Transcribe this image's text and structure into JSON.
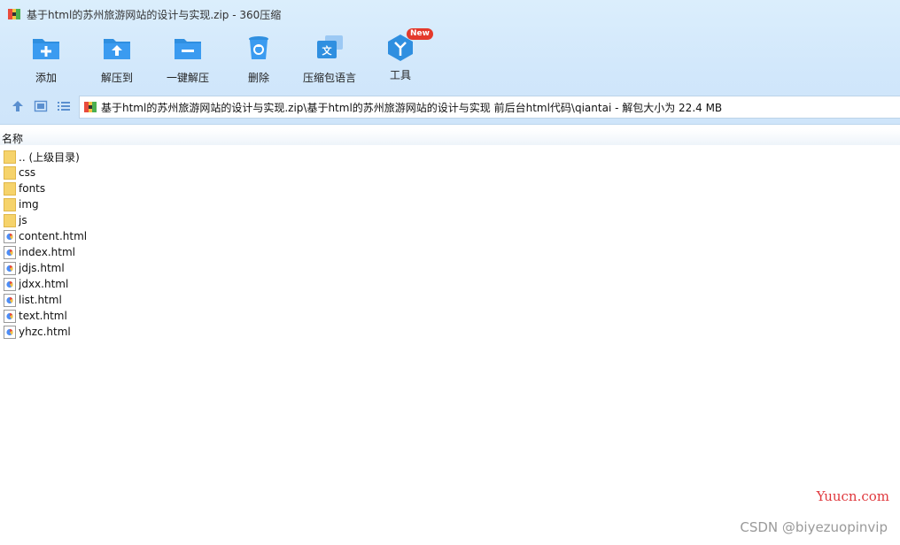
{
  "window": {
    "title": "基于html的苏州旅游网站的设计与实现.zip - 360压缩"
  },
  "toolbar": {
    "items": [
      {
        "label": "添加",
        "icon": "add-folder-icon"
      },
      {
        "label": "解压到",
        "icon": "extract-to-icon"
      },
      {
        "label": "一键解压",
        "icon": "one-click-extract-icon"
      },
      {
        "label": "删除",
        "icon": "delete-trash-icon"
      },
      {
        "label": "压缩包语言",
        "icon": "language-icon"
      },
      {
        "label": "工具",
        "icon": "tools-cube-icon",
        "badge": "New"
      }
    ]
  },
  "nav": {
    "path": "基于html的苏州旅游网站的设计与实现.zip\\基于html的苏州旅游网站的设计与实现 前后台html代码\\qiantai - 解包大小为 22.4 MB"
  },
  "list": {
    "column_name": "名称",
    "folders": [
      {
        "name": ".. (上级目录)"
      },
      {
        "name": "css"
      },
      {
        "name": "fonts"
      },
      {
        "name": "img"
      },
      {
        "name": "js"
      }
    ],
    "files": [
      {
        "name": "content.html"
      },
      {
        "name": "index.html"
      },
      {
        "name": "jdjs.html"
      },
      {
        "name": "jdxx.html"
      },
      {
        "name": "list.html"
      },
      {
        "name": "text.html"
      },
      {
        "name": "yhzc.html"
      }
    ]
  },
  "watermarks": {
    "site": "Yuucn.com",
    "author": "CSDN @biyezuopinvip"
  },
  "colors": {
    "toolbar_blue": "#2f8fe0",
    "badge_red": "#e4392b",
    "folder_yellow": "#f6d36b"
  }
}
